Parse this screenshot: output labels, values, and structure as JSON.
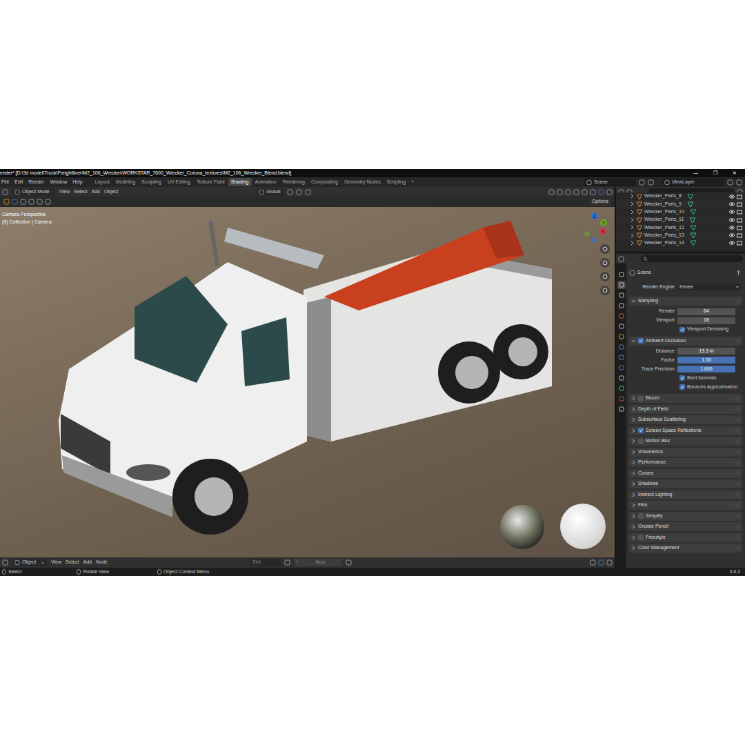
{
  "window": {
    "title": "ender* [D:\\3d model\\Truck\\Freightliner\\M2_106_Wrecker\\WORKSTAR_7600_Wrecker_Corona_textures\\M2_106_Wrecker_Blend.blend]",
    "controls": [
      "—",
      "❐",
      "✕"
    ]
  },
  "menu": [
    "File",
    "Edit",
    "Render",
    "Window",
    "Help"
  ],
  "workspaces": [
    {
      "label": "Layout",
      "selected": false
    },
    {
      "label": "Modeling",
      "selected": false
    },
    {
      "label": "Sculpting",
      "selected": false
    },
    {
      "label": "UV Editing",
      "selected": false
    },
    {
      "label": "Texture Paint",
      "selected": false
    },
    {
      "label": "Shading",
      "selected": true
    },
    {
      "label": "Animation",
      "selected": false
    },
    {
      "label": "Rendering",
      "selected": false
    },
    {
      "label": "Compositing",
      "selected": false
    },
    {
      "label": "Geometry Nodes",
      "selected": false
    },
    {
      "label": "Scripting",
      "selected": false
    }
  ],
  "add_workspace": "+",
  "scene_selector": "Scene",
  "view_layer": "ViewLayer",
  "viewport": {
    "mode": "Object Mode",
    "menus": [
      "View",
      "Select",
      "Add",
      "Object"
    ],
    "orientation": "Global",
    "options": "Options",
    "overlay_lines": [
      "Camera Perspective",
      "(5) Collection | Camera"
    ],
    "gizmo": [
      {
        "label": "Z",
        "color": "#2f6fd6"
      },
      {
        "label": "Y",
        "color": "#6aa626"
      },
      {
        "label": "X",
        "color": "#d23a4a"
      }
    ]
  },
  "node_editor": {
    "type": "Object",
    "menus": [
      "View",
      "Select",
      "Add",
      "Node"
    ],
    "slot": "Slot",
    "new_icon": "+",
    "new_label": "New"
  },
  "outliner": {
    "items": [
      {
        "name": "Wrecker_Parts_8",
        "visible": true
      },
      {
        "name": "Wrecker_Parts_9",
        "visible": true
      },
      {
        "name": "Wrecker_Parts_10",
        "visible": true
      },
      {
        "name": "Wrecker_Parts_11",
        "visible": true
      },
      {
        "name": "Wrecker_Parts_12",
        "visible": true
      },
      {
        "name": "Wrecker_Parts_13",
        "visible": true
      },
      {
        "name": "Wrecker_Parts_14",
        "visible": true
      }
    ]
  },
  "properties": {
    "tabs": [
      {
        "selected": false
      },
      {
        "selected": true
      },
      {
        "selected": false
      },
      {
        "selected": false
      },
      {
        "selected": false
      },
      {
        "selected": false
      },
      {
        "selected": false
      },
      {
        "selected": false
      },
      {
        "selected": false
      },
      {
        "selected": false
      },
      {
        "selected": false
      },
      {
        "selected": false
      },
      {
        "selected": false
      },
      {
        "selected": false
      }
    ],
    "context": "Scene",
    "render_engine": {
      "label": "Render Engine",
      "value": "Eevee"
    },
    "sections": [
      {
        "label": "Sampling",
        "kind": "plain",
        "expanded": true,
        "rows": [
          {
            "kind": "field",
            "label": "Render",
            "value": "64"
          },
          {
            "kind": "field",
            "label": "Viewport",
            "value": "16"
          },
          {
            "kind": "check",
            "label": "Viewport Denoising",
            "checked": true
          }
        ]
      },
      {
        "label": "Ambient Occlusion",
        "kind": "toggle",
        "checked": true,
        "expanded": true,
        "rows": [
          {
            "kind": "field",
            "label": "Distance",
            "value": "13.3 m"
          },
          {
            "kind": "slider",
            "label": "Factor",
            "value": "1.00",
            "level": 1
          },
          {
            "kind": "slider",
            "label": "Trace Precision",
            "value": "1.000",
            "level": 1
          },
          {
            "kind": "check",
            "label": "Bent Normals",
            "checked": true
          },
          {
            "kind": "check",
            "label": "Bounces Approximation",
            "checked": true
          }
        ]
      },
      {
        "label": "Bloom",
        "kind": "toggle",
        "checked": false,
        "expanded": false,
        "rows": []
      },
      {
        "label": "Depth of Field",
        "kind": "plain",
        "expanded": false,
        "rows": []
      },
      {
        "label": "Subsurface Scattering",
        "kind": "plain",
        "expanded": false,
        "rows": []
      },
      {
        "label": "Screen Space Reflections",
        "kind": "toggle",
        "checked": true,
        "expanded": false,
        "rows": []
      },
      {
        "label": "Motion Blur",
        "kind": "toggle",
        "checked": false,
        "expanded": false,
        "rows": []
      },
      {
        "label": "Volumetrics",
        "kind": "plain",
        "expanded": false,
        "rows": []
      },
      {
        "label": "Performance",
        "kind": "plain",
        "expanded": false,
        "rows": []
      },
      {
        "label": "Curves",
        "kind": "plain",
        "expanded": false,
        "rows": []
      },
      {
        "label": "Shadows",
        "kind": "plain",
        "expanded": false,
        "rows": []
      },
      {
        "label": "Indirect Lighting",
        "kind": "plain",
        "expanded": false,
        "rows": []
      },
      {
        "label": "Film",
        "kind": "plain",
        "expanded": false,
        "rows": []
      },
      {
        "label": "Simplify",
        "kind": "toggle",
        "checked": false,
        "expanded": false,
        "rows": []
      },
      {
        "label": "Grease Pencil",
        "kind": "plain",
        "expanded": false,
        "rows": []
      },
      {
        "label": "Freestyle",
        "kind": "toggle",
        "checked": false,
        "expanded": false,
        "rows": []
      },
      {
        "label": "Color Management",
        "kind": "plain",
        "expanded": false,
        "rows": []
      }
    ]
  },
  "status_bar": {
    "items": [
      "Select",
      "Rotate View",
      "Object Context Menu"
    ],
    "version": "3.6.2"
  }
}
